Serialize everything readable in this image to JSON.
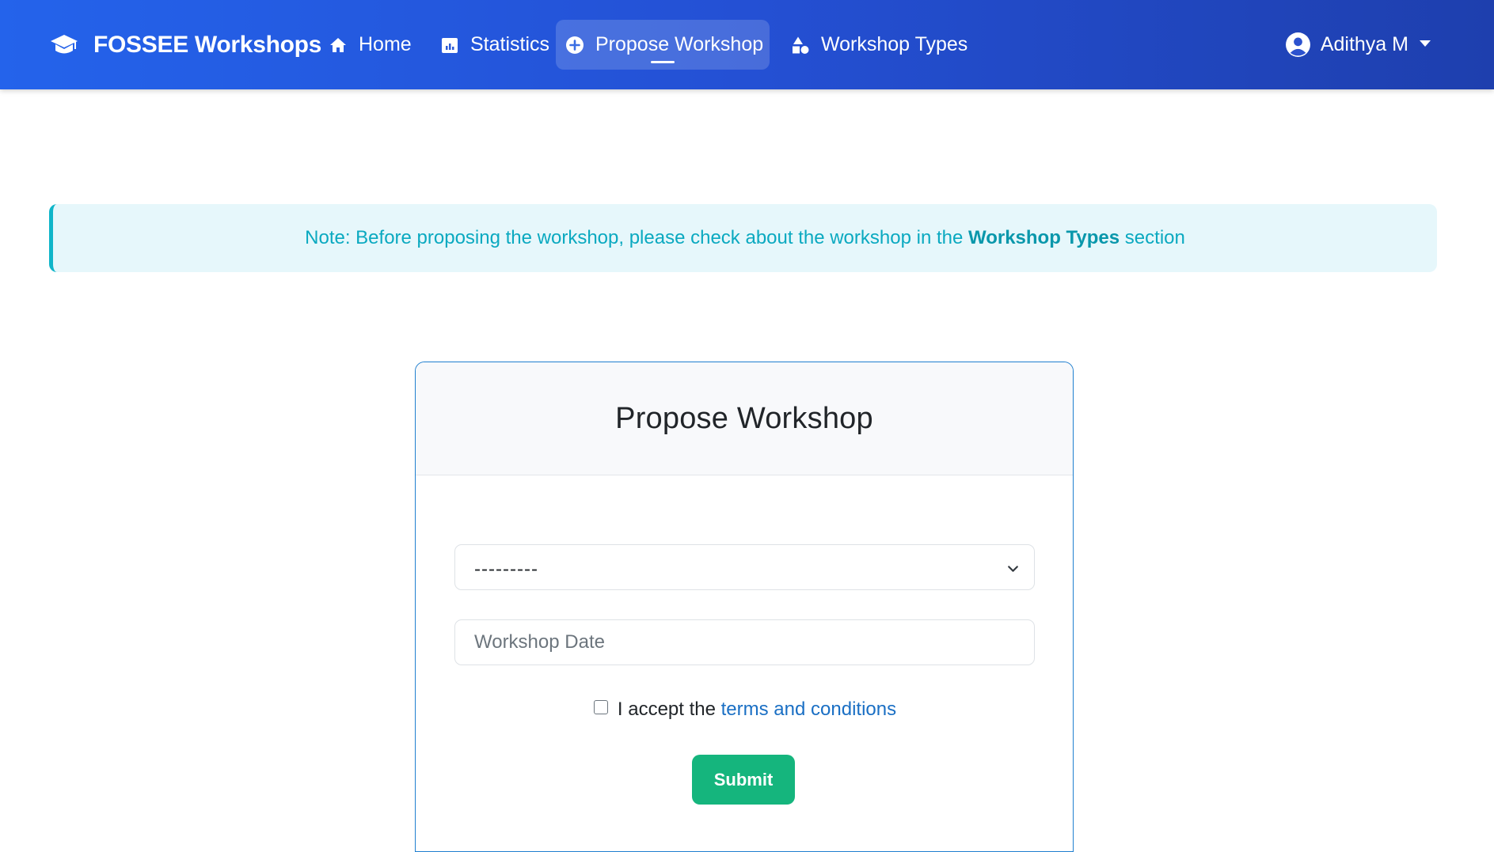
{
  "navbar": {
    "brand": "FOSSEE Workshops",
    "items": [
      {
        "label": "Home",
        "icon": "home-icon",
        "active": false
      },
      {
        "label": "Statistics",
        "icon": "chart-icon",
        "active": false
      },
      {
        "label": "Propose Workshop",
        "icon": "plus-circle-icon",
        "active": true
      },
      {
        "label": "Workshop Types",
        "icon": "shapes-icon",
        "active": false
      }
    ],
    "user": {
      "name": "Adithya M",
      "icon": "user-circle-icon"
    }
  },
  "alert": {
    "prefix": "Note: Before proposing the workshop, please check about the workshop in the ",
    "emphasis": "Workshop Types",
    "suffix": " section"
  },
  "form": {
    "title": "Propose Workshop",
    "workshop_select": {
      "selected": "---------"
    },
    "date_field": {
      "placeholder": "Workshop Date",
      "value": ""
    },
    "terms": {
      "prefix": "I accept the ",
      "link": "terms and conditions",
      "checked": false
    },
    "submit_label": "Submit"
  },
  "colors": {
    "navbar_start": "#2463eb",
    "navbar_end": "#1e3fae",
    "alert_bg": "#e6f7fb",
    "alert_text": "#0aa9c0",
    "card_border": "#1f7fcf",
    "submit_bg": "#15b57d",
    "link": "#1a6fc4"
  }
}
